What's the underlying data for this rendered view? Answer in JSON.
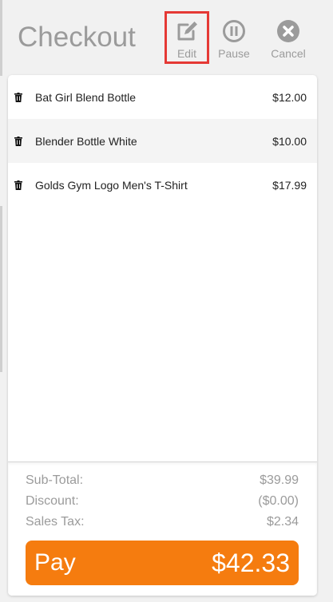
{
  "header": {
    "title": "Checkout",
    "edit_label": "Edit",
    "pause_label": "Pause",
    "cancel_label": "Cancel"
  },
  "items": [
    {
      "name": "Bat Girl Blend Bottle",
      "price": "$12.00"
    },
    {
      "name": "Blender Bottle White",
      "price": "$10.00"
    },
    {
      "name": "Golds Gym Logo Men's T-Shirt",
      "price": "$17.99"
    }
  ],
  "summary": {
    "subtotal_label": "Sub-Total:",
    "subtotal_value": "$39.99",
    "discount_label": "Discount:",
    "discount_value": "($0.00)",
    "tax_label": "Sales Tax:",
    "tax_value": "$2.34"
  },
  "pay": {
    "label": "Pay",
    "amount": "$42.33"
  },
  "colors": {
    "accent": "#f57c0f",
    "highlight_border": "#e53935",
    "muted_text": "#9b9b9b"
  },
  "icons": [
    "edit-icon",
    "pause-icon",
    "cancel-icon",
    "trash-icon"
  ]
}
